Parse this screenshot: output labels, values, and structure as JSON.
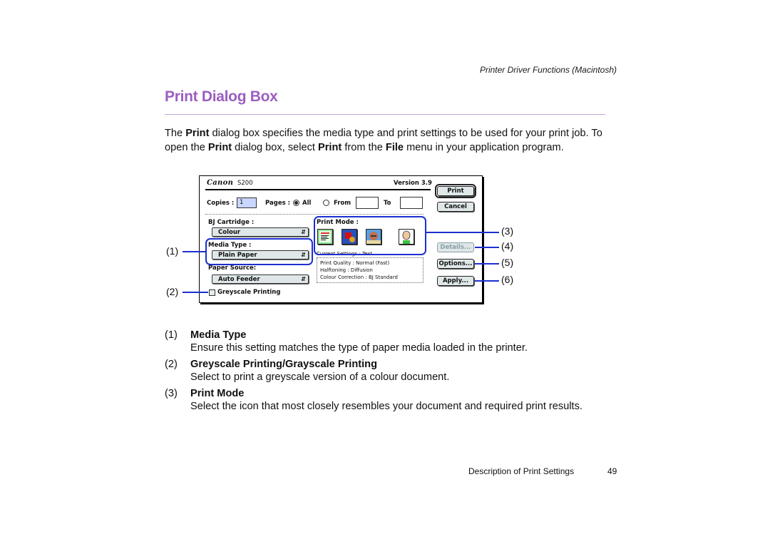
{
  "page": {
    "running_head": "Printer Driver Functions (Macintosh)",
    "title": "Print Dialog Box",
    "title_color": "#9b5fc0",
    "intro": {
      "part1": "The ",
      "bold1": "Print",
      "part2": " dialog box specifies the media type and print settings to be used for your print job. To open the ",
      "bold2": "Print",
      "part3": " dialog box, select ",
      "bold3": "Print",
      "part4": " from the ",
      "bold4": "File",
      "part5": " menu in your application program."
    },
    "footer": {
      "section": "Description of Print Settings",
      "page_number": "49"
    }
  },
  "dialog": {
    "brand": "Canon",
    "model": "S200",
    "version": "Version 3.9",
    "copies_label": "Copies :",
    "copies_value": "1",
    "pages_label": "Pages :",
    "pages_all_label": "All",
    "pages_all_selected": true,
    "pages_from_label": "From",
    "pages_from_value": "",
    "pages_to_label": "To",
    "pages_to_value": "",
    "bj_cartridge_label": "BJ Cartridge :",
    "bj_cartridge_value": "Colour",
    "media_type_label": "Media Type :",
    "media_type_value": "Plain Paper",
    "paper_source_label": "Paper Source:",
    "paper_source_value": "Auto Feeder",
    "greyscale_label": "Greyscale Printing",
    "greyscale_checked": false,
    "print_mode_label": "Print Mode :",
    "print_mode_icons": [
      {
        "name": "text-mode-icon",
        "selected": true
      },
      {
        "name": "graphics-mode-icon",
        "selected": false
      },
      {
        "name": "photo-mode-icon",
        "selected": false
      },
      {
        "name": "illustration-mode-icon",
        "selected": false
      }
    ],
    "current_settings": "Current Settings : Text",
    "settings_lines": [
      "Print Quality : Normal (Fast)",
      "Halftoning : Diffusion",
      "Colour Correction : BJ Standard"
    ],
    "buttons": {
      "print": "Print",
      "cancel": "Cancel",
      "details": "Details...",
      "options": "Options...",
      "apply": "Apply..."
    },
    "details_enabled": false
  },
  "callouts": {
    "c1": "(1)",
    "c2": "(2)",
    "c3": "(3)",
    "c4": "(4)",
    "c5": "(5)",
    "c6": "(6)",
    "color": "#1c2fd0"
  },
  "items": [
    {
      "num": "(1)",
      "heading": "Media Type",
      "desc": "Ensure this setting matches the type of paper media loaded in the printer."
    },
    {
      "num": "(2)",
      "heading": "Greyscale Printing/Grayscale Printing",
      "desc": "Select to print a greyscale version of a colour document."
    },
    {
      "num": "(3)",
      "heading": "Print Mode",
      "desc": "Select the icon that most closely resembles your document and required print results."
    }
  ]
}
